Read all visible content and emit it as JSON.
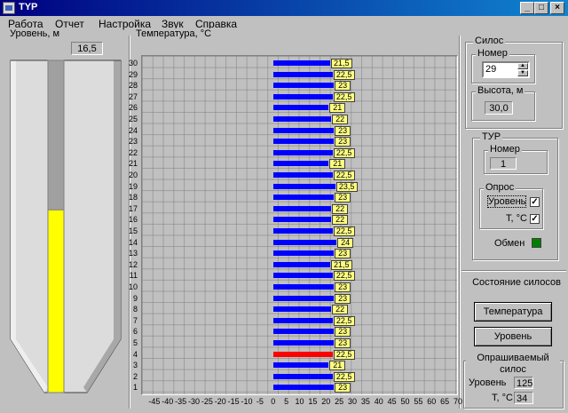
{
  "window": {
    "title": "TYP"
  },
  "menu": [
    "Работа",
    "Отчет",
    "Настройка",
    "Звук",
    "Справка"
  ],
  "level_panel": {
    "label": "Уровень, м",
    "value": "16,5",
    "fill_fraction": 0.55,
    "fill_color": "#ffff00"
  },
  "temp_panel": {
    "label": "Температура, °C"
  },
  "chart_data": {
    "type": "bar",
    "orientation": "horizontal",
    "categories": [
      30,
      29,
      28,
      27,
      26,
      25,
      24,
      23,
      22,
      21,
      20,
      19,
      18,
      17,
      16,
      15,
      14,
      13,
      12,
      11,
      10,
      9,
      8,
      7,
      6,
      5,
      4,
      3,
      2,
      1
    ],
    "values": [
      21.5,
      22.5,
      23,
      22.5,
      21,
      22,
      23,
      23,
      22.5,
      21,
      22.5,
      23.5,
      23,
      22,
      22,
      22.5,
      24,
      23,
      21.5,
      22.5,
      23,
      23,
      22,
      22.5,
      23,
      23,
      22.5,
      21,
      22.5,
      23
    ],
    "labels": [
      "21,5",
      "22,5",
      "23",
      "22,5",
      "21",
      "22",
      "23",
      "23",
      "22,5",
      "21",
      "22,5",
      "23,5",
      "23",
      "22",
      "22",
      "22,5",
      "24",
      "23",
      "21,5",
      "22,5",
      "23",
      "23",
      "22",
      "22,5",
      "23",
      "23",
      "22,5",
      "21",
      "22,5",
      "23"
    ],
    "highlight_category": 4,
    "bar_color": "#0000ff",
    "highlight_color": "#ff0000",
    "xlim": [
      -50,
      70
    ],
    "xticks": [
      "-45",
      "-40",
      "-35",
      "-30",
      "-25",
      "-20",
      "-15",
      "-10",
      "-5",
      "0",
      "5",
      "10",
      "15",
      "20",
      "25",
      "30",
      "35",
      "40",
      "45",
      "50",
      "55",
      "60",
      "65",
      "70"
    ],
    "grid": true
  },
  "silo_group": {
    "title": "Силос",
    "number_label": "Номер",
    "number_value": "29",
    "height_label": "Высота, м",
    "height_value": "30,0"
  },
  "tur_group": {
    "title": "ТУР",
    "number_label": "Номер",
    "number_value": "1",
    "poll_title": "Опрос",
    "poll_level": "Уровень",
    "poll_temp": "Т, °С",
    "exchange_label": "Обмен",
    "exchange_color": "#008000"
  },
  "state_group": {
    "title": "Состояние силосов",
    "temp_button": "Температура",
    "level_button": "Уровень"
  },
  "polled_group": {
    "title": "Опрашиваемый силос",
    "level_label": "Уровень",
    "level_value": "125",
    "temp_label": "Т, °С",
    "temp_value": "34"
  }
}
